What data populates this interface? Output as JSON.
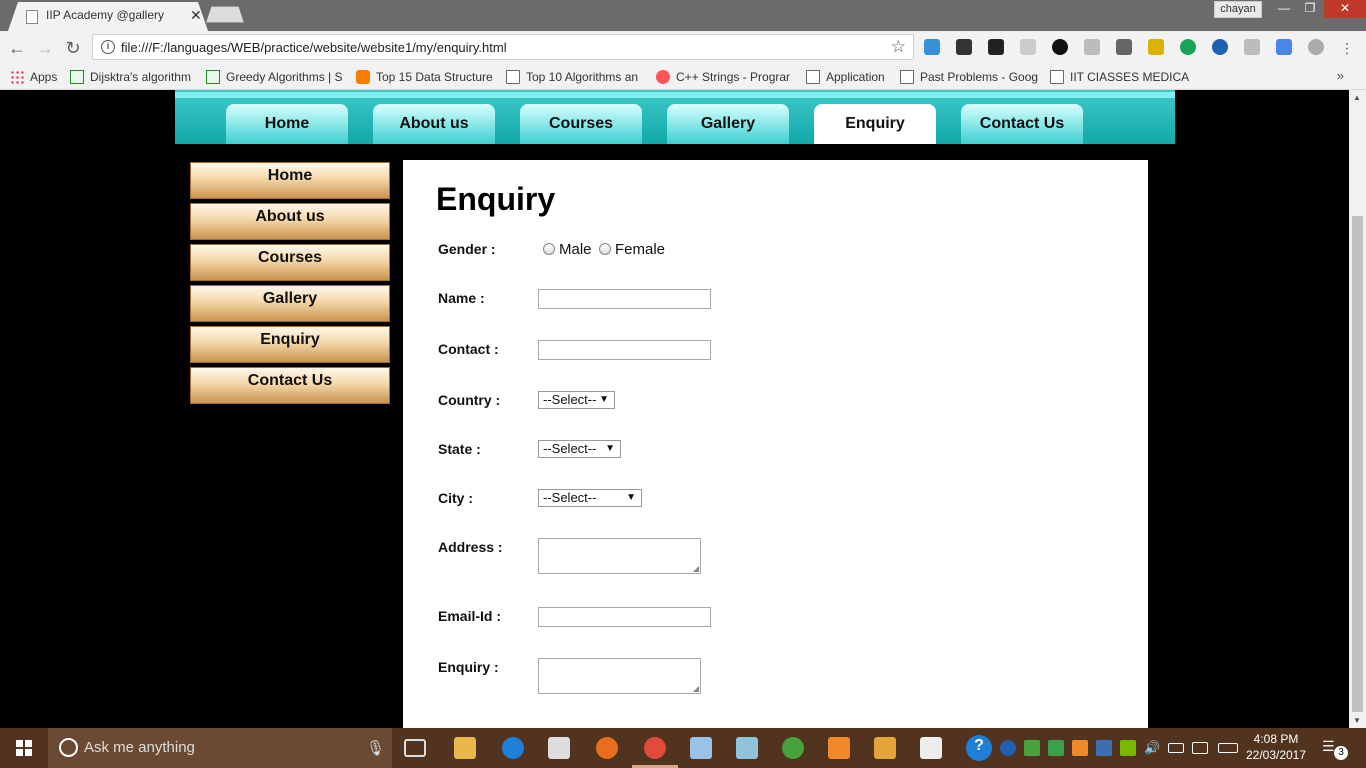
{
  "browser": {
    "tab_title": "IIP Academy @gallery",
    "tab_close": "✕",
    "user": "chayan",
    "url": "file:///F:/languages/WEB/practice/website/website1/my/enquiry.html"
  },
  "bookmarks": [
    {
      "label": "Apps"
    },
    {
      "label": "Dijsktra's algorithm"
    },
    {
      "label": "Greedy Algorithms | S"
    },
    {
      "label": "Top 15 Data Structure"
    },
    {
      "label": "Top 10 Algorithms an"
    },
    {
      "label": "C++ Strings - Prograr"
    },
    {
      "label": "Application"
    },
    {
      "label": "Past Problems - Goog"
    },
    {
      "label": "IIT CIASSES MEDICAL"
    }
  ],
  "top_nav": [
    {
      "label": "Home"
    },
    {
      "label": "About us"
    },
    {
      "label": "Courses"
    },
    {
      "label": "Gallery"
    },
    {
      "label": "Enquiry",
      "active": true
    },
    {
      "label": "Contact Us"
    }
  ],
  "side_nav": [
    {
      "label": "Home"
    },
    {
      "label": "About us"
    },
    {
      "label": "Courses"
    },
    {
      "label": "Gallery"
    },
    {
      "label": "Enquiry"
    },
    {
      "label": "Contact Us"
    }
  ],
  "form": {
    "title": "Enquiry",
    "gender_label": "Gender :",
    "gender_options": [
      "Male",
      "Female"
    ],
    "name_label": "Name :",
    "name_value": "",
    "contact_label": "Contact :",
    "contact_value": "",
    "country_label": "Country :",
    "country_selected": "--Select--",
    "state_label": "State :",
    "state_selected": "--Select--",
    "city_label": "City :",
    "city_selected": "--Select--",
    "address_label": "Address :",
    "email_label": "Email-Id :",
    "email_value": "",
    "enquiry_label": "Enquiry :"
  },
  "taskbar": {
    "search_placeholder": "Ask me anything",
    "time": "4:08 PM",
    "date": "22/03/2017",
    "notification_count": "3"
  },
  "colors": {
    "nav_teal": "#11a9a9",
    "side_nav_tan": "#c9944e",
    "taskbar": "#51331f",
    "page_background": "#000000"
  }
}
